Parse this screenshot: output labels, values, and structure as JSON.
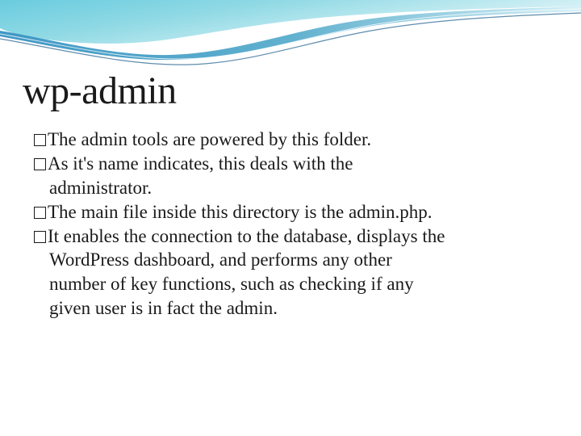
{
  "slide": {
    "title": "wp-admin",
    "bullets": [
      {
        "lines": [
          "The admin tools are powered by this folder."
        ]
      },
      {
        "lines": [
          "As it's name indicates, this deals with the",
          "administrator."
        ]
      },
      {
        "lines": [
          "The main file inside this directory is the admin.php."
        ]
      },
      {
        "lines": [
          "It enables the connection to the database, displays the",
          "WordPress dashboard, and performs any other",
          "number of key functions, such as checking if any",
          "given user is in fact the admin."
        ]
      }
    ]
  }
}
